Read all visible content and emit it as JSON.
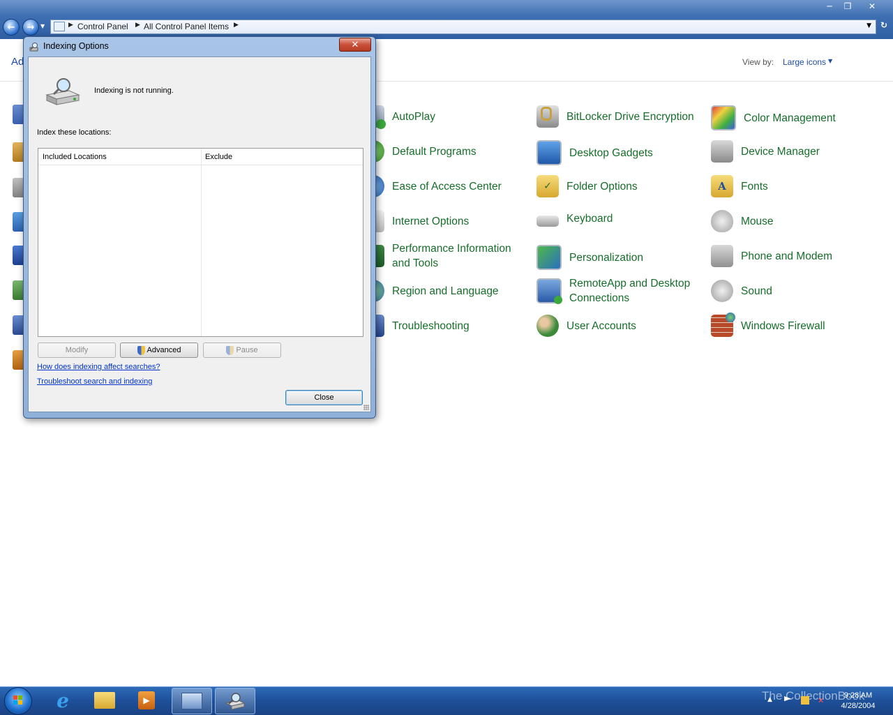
{
  "window": {
    "controls": [
      "minimize",
      "restore",
      "close"
    ]
  },
  "address": {
    "crumbs": [
      "Control Panel",
      "All Control Panel Items"
    ]
  },
  "control_panel": {
    "heading": "Ad",
    "view_by_label": "View by:",
    "view_by_value": "Large icons",
    "items": [
      {
        "label": "AutoPlay",
        "icon": "autoplay-icon"
      },
      {
        "label": "BitLocker Drive Encryption",
        "icon": "bitlocker-icon"
      },
      {
        "label": "Color Management",
        "icon": "color-management-icon"
      },
      {
        "label": "Default Programs",
        "icon": "default-programs-icon"
      },
      {
        "label": "Desktop Gadgets",
        "icon": "desktop-gadgets-icon"
      },
      {
        "label": "Device Manager",
        "icon": "device-manager-icon"
      },
      {
        "label": "Ease of Access Center",
        "icon": "ease-of-access-icon"
      },
      {
        "label": "Folder Options",
        "icon": "folder-options-icon"
      },
      {
        "label": "Fonts",
        "icon": "fonts-icon"
      },
      {
        "label": "Internet Options",
        "icon": "internet-options-icon"
      },
      {
        "label": "Keyboard",
        "icon": "keyboard-icon"
      },
      {
        "label": "Mouse",
        "icon": "mouse-icon"
      },
      {
        "label": "Performance Information and Tools",
        "icon": "performance-icon"
      },
      {
        "label": "Personalization",
        "icon": "personalization-icon"
      },
      {
        "label": "Phone and Modem",
        "icon": "phone-modem-icon"
      },
      {
        "label": "Region and Language",
        "icon": "region-language-icon"
      },
      {
        "label": "RemoteApp and Desktop Connections",
        "icon": "remoteapp-icon"
      },
      {
        "label": "Sound",
        "icon": "sound-icon"
      },
      {
        "label": "Troubleshooting",
        "icon": "troubleshooting-icon"
      },
      {
        "label": "User Accounts",
        "icon": "user-accounts-icon"
      },
      {
        "label": "Windows Firewall",
        "icon": "windows-firewall-icon"
      }
    ]
  },
  "dialog": {
    "title": "Indexing Options",
    "status": "Indexing is not running.",
    "index_label": "Index these locations:",
    "columns": [
      "Included Locations",
      "Exclude"
    ],
    "buttons": {
      "modify": "Modify",
      "advanced": "Advanced",
      "pause": "Pause",
      "close": "Close"
    },
    "links": [
      "How does indexing affect searches?",
      "Troubleshoot search and indexing"
    ]
  },
  "taskbar": {
    "time": "9:28 AM",
    "date": "4/28/2004",
    "watermark": "The CollectionBook",
    "apps": [
      "internet-explorer-icon",
      "windows-explorer-icon",
      "media-player-icon",
      "control-panel-icon",
      "indexing-options-icon"
    ]
  },
  "colors": {
    "link_green": "#166e2a",
    "link_blue": "#1e4ea0",
    "taskbar": "#1e4f98"
  }
}
